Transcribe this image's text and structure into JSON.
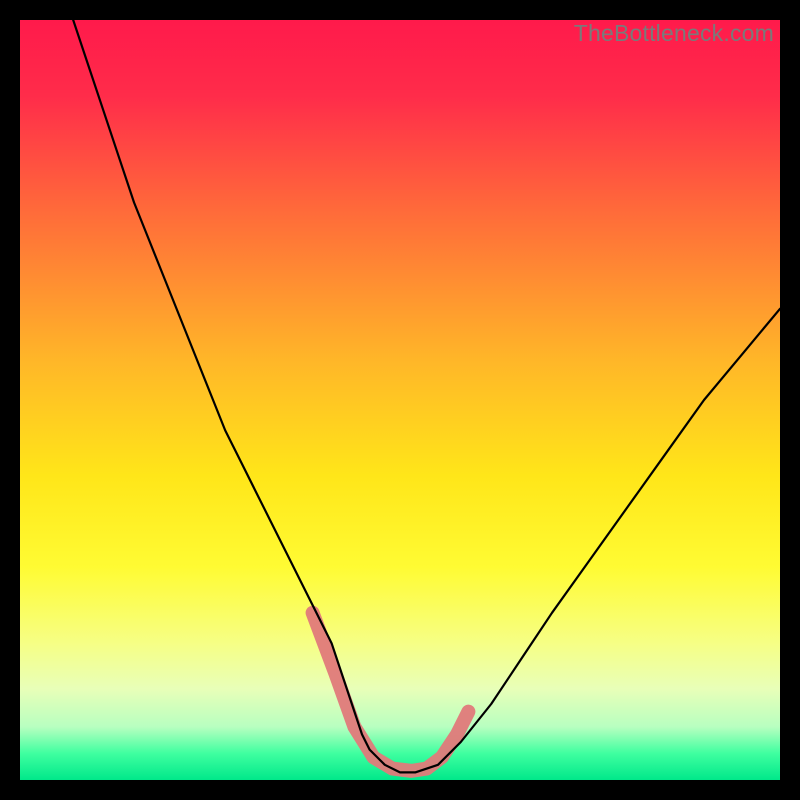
{
  "watermark": "TheBottleneck.com",
  "chart_data": {
    "type": "line",
    "title": "",
    "xlabel": "",
    "ylabel": "",
    "xlim": [
      0,
      100
    ],
    "ylim": [
      0,
      100
    ],
    "gradient_stops": [
      {
        "offset": 0.0,
        "color": "#ff1a4b"
      },
      {
        "offset": 0.1,
        "color": "#ff2c4a"
      },
      {
        "offset": 0.25,
        "color": "#ff6a3a"
      },
      {
        "offset": 0.45,
        "color": "#ffb728"
      },
      {
        "offset": 0.6,
        "color": "#ffe619"
      },
      {
        "offset": 0.72,
        "color": "#fffb33"
      },
      {
        "offset": 0.82,
        "color": "#f6ff85"
      },
      {
        "offset": 0.88,
        "color": "#e8ffb8"
      },
      {
        "offset": 0.93,
        "color": "#b8ffc0"
      },
      {
        "offset": 0.965,
        "color": "#3fffa0"
      },
      {
        "offset": 1.0,
        "color": "#00e88a"
      }
    ],
    "series": [
      {
        "name": "bottleneck-curve",
        "stroke": "#000000",
        "stroke_width": 2.2,
        "x": [
          7,
          9,
          11,
          13,
          15,
          17,
          19,
          21,
          23,
          25,
          27,
          29,
          31,
          33,
          35,
          37,
          39,
          40,
          41,
          42,
          43,
          44,
          45,
          46,
          48,
          50,
          52,
          55,
          58,
          62,
          66,
          70,
          75,
          80,
          85,
          90,
          95,
          100
        ],
        "y": [
          100,
          94,
          88,
          82,
          76,
          71,
          66,
          61,
          56,
          51,
          46,
          42,
          38,
          34,
          30,
          26,
          22,
          20,
          18,
          15,
          12,
          9,
          6,
          4,
          2,
          1,
          1,
          2,
          5,
          10,
          16,
          22,
          29,
          36,
          43,
          50,
          56,
          62
        ]
      }
    ],
    "highlight": {
      "name": "bottom-highlight",
      "stroke": "#e07a7a",
      "stroke_width": 14,
      "opacity": 0.95,
      "points": [
        {
          "x": 38.5,
          "y": 22
        },
        {
          "x": 41.5,
          "y": 14
        },
        {
          "x": 44.0,
          "y": 7
        },
        {
          "x": 46.5,
          "y": 3
        },
        {
          "x": 49.0,
          "y": 1.5
        },
        {
          "x": 51.5,
          "y": 1.2
        },
        {
          "x": 53.5,
          "y": 1.5
        },
        {
          "x": 55.5,
          "y": 3
        },
        {
          "x": 57.5,
          "y": 6
        },
        {
          "x": 59.0,
          "y": 9
        }
      ]
    }
  }
}
